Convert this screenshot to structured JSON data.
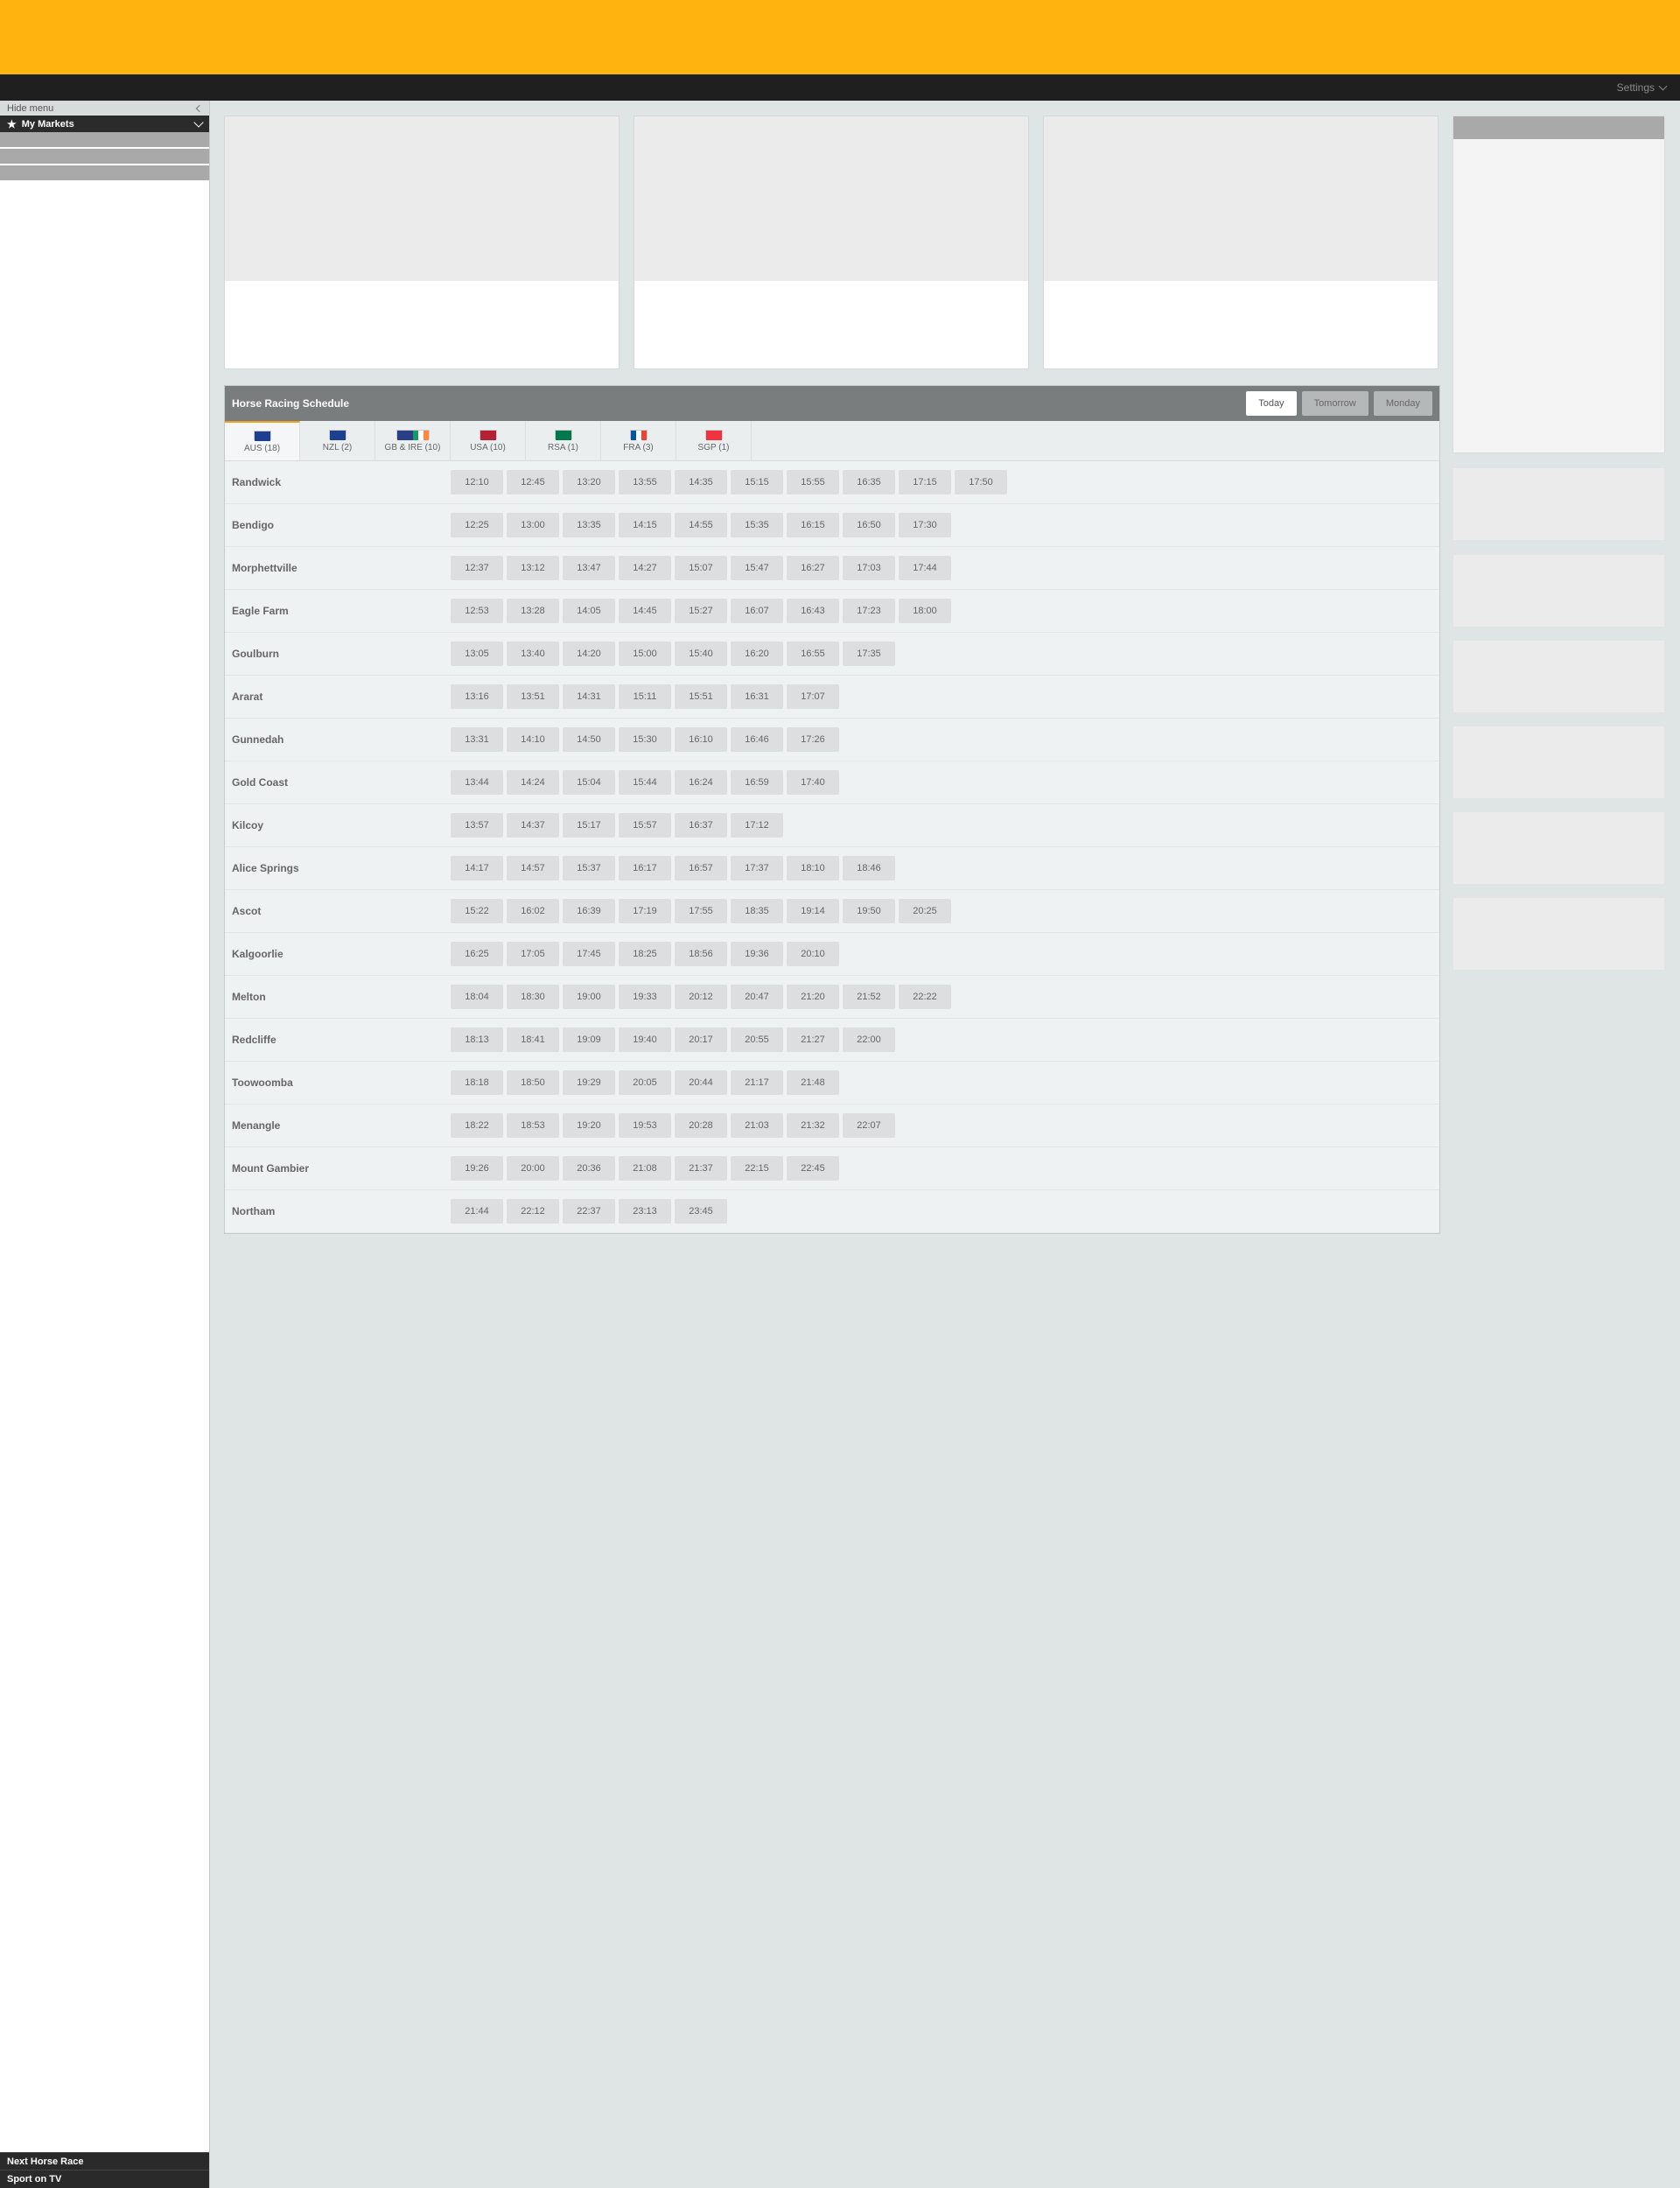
{
  "header": {
    "settings_label": "Settings"
  },
  "sidebar": {
    "hide_menu": "Hide menu",
    "my_markets": "My Markets",
    "bottom_items": [
      "Next Horse Race",
      "Sport on TV"
    ]
  },
  "schedule": {
    "title": "Horse Racing Schedule",
    "day_buttons": [
      "Today",
      "Tomorrow",
      "Monday"
    ],
    "active_day": "Today",
    "tabs": [
      {
        "label": "AUS (18)",
        "flag": "australia-flag-icon"
      },
      {
        "label": "NZL (2)",
        "flag": "new-zealand-flag-icon"
      },
      {
        "label": "GB & IRE (10)",
        "flag": "gb-ireland-flag-icon"
      },
      {
        "label": "USA (10)",
        "flag": "usa-flag-icon"
      },
      {
        "label": "RSA (1)",
        "flag": "south-africa-flag-icon"
      },
      {
        "label": "FRA (3)",
        "flag": "france-flag-icon"
      },
      {
        "label": "SGP (1)",
        "flag": "singapore-flag-icon"
      }
    ],
    "active_tab": "AUS (18)",
    "venues": [
      {
        "name": "Randwick",
        "times": [
          "12:10",
          "12:45",
          "13:20",
          "13:55",
          "14:35",
          "15:15",
          "15:55",
          "16:35",
          "17:15",
          "17:50"
        ]
      },
      {
        "name": "Bendigo",
        "times": [
          "12:25",
          "13:00",
          "13:35",
          "14:15",
          "14:55",
          "15:35",
          "16:15",
          "16:50",
          "17:30"
        ]
      },
      {
        "name": "Morphettville",
        "times": [
          "12:37",
          "13:12",
          "13:47",
          "14:27",
          "15:07",
          "15:47",
          "16:27",
          "17:03",
          "17:44"
        ]
      },
      {
        "name": "Eagle Farm",
        "times": [
          "12:53",
          "13:28",
          "14:05",
          "14:45",
          "15:27",
          "16:07",
          "16:43",
          "17:23",
          "18:00"
        ]
      },
      {
        "name": "Goulburn",
        "times": [
          "13:05",
          "13:40",
          "14:20",
          "15:00",
          "15:40",
          "16:20",
          "16:55",
          "17:35"
        ]
      },
      {
        "name": "Ararat",
        "times": [
          "13:16",
          "13:51",
          "14:31",
          "15:11",
          "15:51",
          "16:31",
          "17:07"
        ]
      },
      {
        "name": "Gunnedah",
        "times": [
          "13:31",
          "14:10",
          "14:50",
          "15:30",
          "16:10",
          "16:46",
          "17:26"
        ]
      },
      {
        "name": "Gold Coast",
        "times": [
          "13:44",
          "14:24",
          "15:04",
          "15:44",
          "16:24",
          "16:59",
          "17:40"
        ]
      },
      {
        "name": "Kilcoy",
        "times": [
          "13:57",
          "14:37",
          "15:17",
          "15:57",
          "16:37",
          "17:12"
        ]
      },
      {
        "name": "Alice Springs",
        "times": [
          "14:17",
          "14:57",
          "15:37",
          "16:17",
          "16:57",
          "17:37",
          "18:10",
          "18:46"
        ]
      },
      {
        "name": "Ascot",
        "times": [
          "15:22",
          "16:02",
          "16:39",
          "17:19",
          "17:55",
          "18:35",
          "19:14",
          "19:50",
          "20:25"
        ]
      },
      {
        "name": "Kalgoorlie",
        "times": [
          "16:25",
          "17:05",
          "17:45",
          "18:25",
          "18:56",
          "19:36",
          "20:10"
        ]
      },
      {
        "name": "Melton",
        "times": [
          "18:04",
          "18:30",
          "19:00",
          "19:33",
          "20:12",
          "20:47",
          "21:20",
          "21:52",
          "22:22"
        ]
      },
      {
        "name": "Redcliffe",
        "times": [
          "18:13",
          "18:41",
          "19:09",
          "19:40",
          "20:17",
          "20:55",
          "21:27",
          "22:00"
        ]
      },
      {
        "name": "Toowoomba",
        "times": [
          "18:18",
          "18:50",
          "19:29",
          "20:05",
          "20:44",
          "21:17",
          "21:48"
        ]
      },
      {
        "name": "Menangle",
        "times": [
          "18:22",
          "18:53",
          "19:20",
          "19:53",
          "20:28",
          "21:03",
          "21:32",
          "22:07"
        ]
      },
      {
        "name": "Mount Gambier",
        "times": [
          "19:26",
          "20:00",
          "20:36",
          "21:08",
          "21:37",
          "22:15",
          "22:45"
        ]
      },
      {
        "name": "Northam",
        "times": [
          "21:44",
          "22:12",
          "22:37",
          "23:13",
          "23:45"
        ]
      }
    ]
  },
  "colors": {
    "brand_yellow": "#ffb30f",
    "nav_dark": "#1f1f1f",
    "tab_accent": "#f0a020",
    "header_gray": "#7a7d7e"
  }
}
